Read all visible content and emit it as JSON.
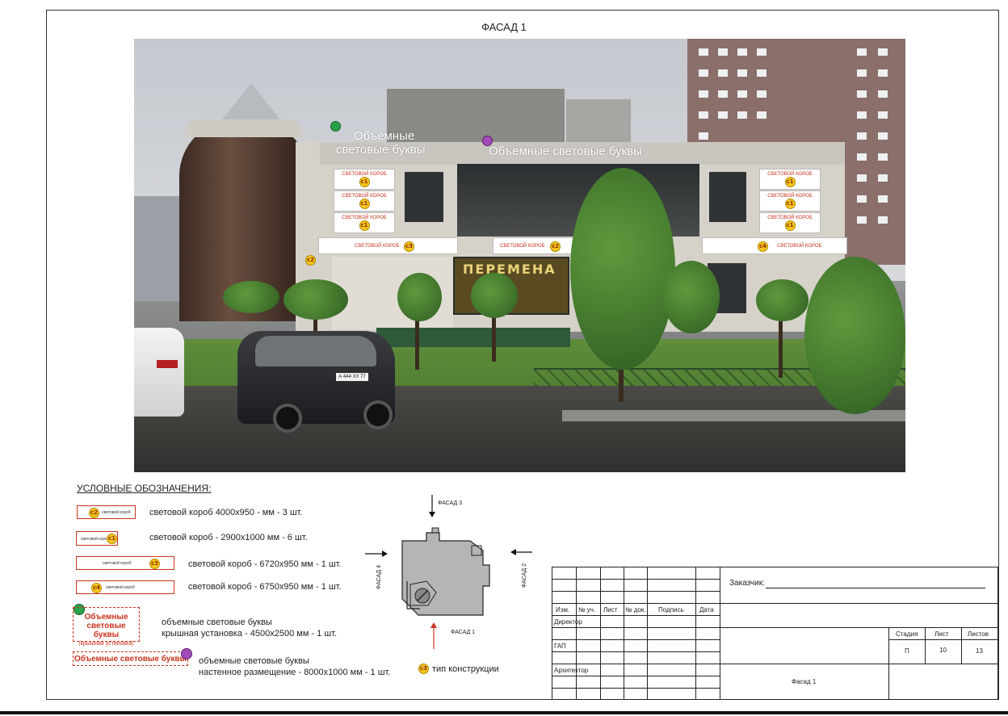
{
  "sheet": {
    "title": "ФАСАД 1"
  },
  "photo": {
    "roof_text_left_1": "Объемные",
    "roof_text_left_2": "световые буквы",
    "roof_text_right": "Объемные световые буквы",
    "sign_label": "СВЕТОВОЙ КОРОБ",
    "shop_text": "ПЕРЕМЕНА",
    "car_plate": "А 444 ХУ 77",
    "tags": {
      "c1": "с1",
      "c2": "с2",
      "c3": "с3",
      "c4": "с4"
    }
  },
  "legend": {
    "title": "УСЛОВНЫЕ ОБОЗНАЧЕНИЯ:",
    "mini_label": "световой короб",
    "items": [
      {
        "tag": "с2",
        "text": "световой короб 4000х950 -  мм - 3 шт."
      },
      {
        "tag": "с1",
        "text": "световой короб - 2900х1000 мм - 6 шт."
      },
      {
        "tag": "с3",
        "text": "световой короб - 6720х950 мм - 1 шт."
      },
      {
        "tag": "с4",
        "text": "световой короб - 6750х950 мм - 1 шт."
      }
    ],
    "roof_box_line1": "Объемные",
    "roof_box_line2": "световые буквы",
    "roof_box_line3": "(крышная установка)",
    "roof_desc_1": "объемные световые буквы",
    "roof_desc_2": "крышная установка - 4500х2500 мм - 1 шт.",
    "wall_box": "Объемные световые буквы",
    "wall_desc_1": "объемные световые буквы",
    "wall_desc_2": "настенное размещение - 8000х1000 мм - 1 шт."
  },
  "plan": {
    "facade1": "ФАСАД 1",
    "facade2": "ФАСАД 2",
    "facade3": "ФАСАД 3",
    "facade4": "ФАСАД 4",
    "type_tag": "с3",
    "type_text": "тип конструкции"
  },
  "title_block": {
    "customer_label": "Заказчик:",
    "headers": [
      "Изм.",
      "№ уч.",
      "Лист",
      "№ док.",
      "Подпись",
      "Дата"
    ],
    "director": "Директор",
    "gap": "ГАП",
    "architect": "Архитектор",
    "stage_h": "Стадия",
    "sheet_h": "Лист",
    "sheets_h": "Листов",
    "stage": "П",
    "sheet": "10",
    "sheets": "13",
    "sheet_name": "Фасад 1"
  }
}
